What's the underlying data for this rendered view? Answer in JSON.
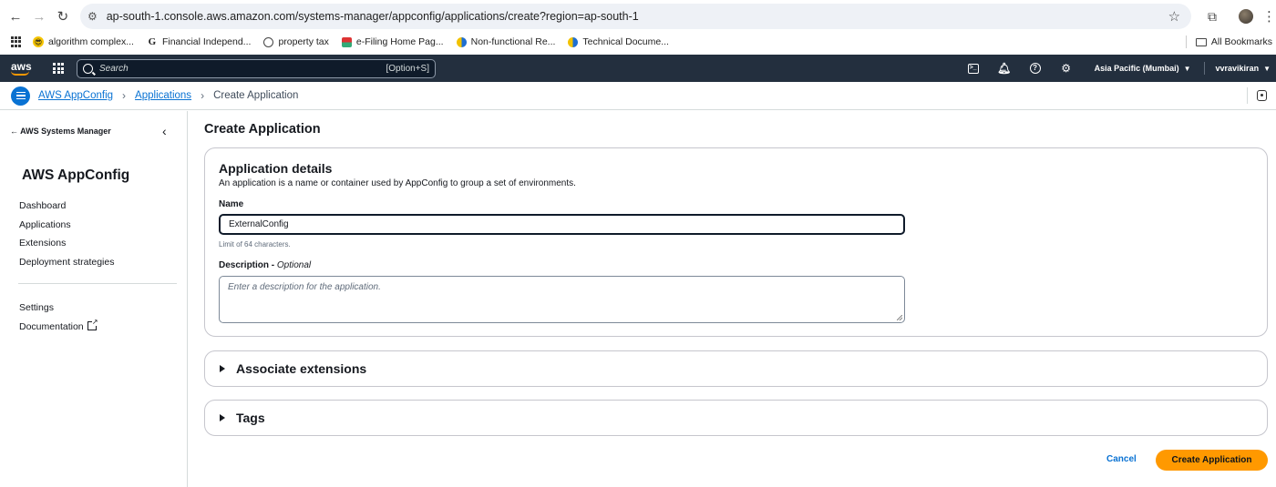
{
  "browser": {
    "url": "ap-south-1.console.aws.amazon.com/systems-manager/appconfig/applications/create?region=ap-south-1",
    "bookmarks": [
      {
        "label": "algorithm complex...",
        "icon": "emoji-icon"
      },
      {
        "label": "Financial Independ...",
        "icon": "g-logo-icon"
      },
      {
        "label": "property tax",
        "icon": "globe-icon"
      },
      {
        "label": "e-Filing Home Pag...",
        "icon": "efiling-icon"
      },
      {
        "label": "Non-functional Re...",
        "icon": "confluence-icon"
      },
      {
        "label": "Technical Docume...",
        "icon": "confluence-icon"
      }
    ],
    "all_bookmarks": "All Bookmarks"
  },
  "aws_nav": {
    "logo": "aws",
    "search_placeholder": "Search",
    "search_shortcut": "[Option+S]",
    "region": "Asia Pacific (Mumbai)",
    "user": "vvravikiran"
  },
  "breadcrumb": {
    "items": [
      "AWS AppConfig",
      "Applications"
    ],
    "current": "Create Application"
  },
  "sidebar": {
    "back_label": "AWS Systems Manager",
    "title": "AWS AppConfig",
    "items": [
      "Dashboard",
      "Applications",
      "Extensions",
      "Deployment strategies"
    ],
    "items2": [
      "Settings",
      "Documentation"
    ]
  },
  "main": {
    "page_title": "Create Application",
    "details": {
      "heading": "Application details",
      "description": "An application is a name or container used by AppConfig to group a set of environments.",
      "name_label": "Name",
      "name_value": "ExternalConfig",
      "name_hint": "Limit of 64 characters.",
      "desc_label": "Description - ",
      "desc_optional": "Optional",
      "desc_placeholder": "Enter a description for the application."
    },
    "associate_extensions": "Associate extensions",
    "tags": "Tags",
    "cancel": "Cancel",
    "create": "Create Application"
  }
}
